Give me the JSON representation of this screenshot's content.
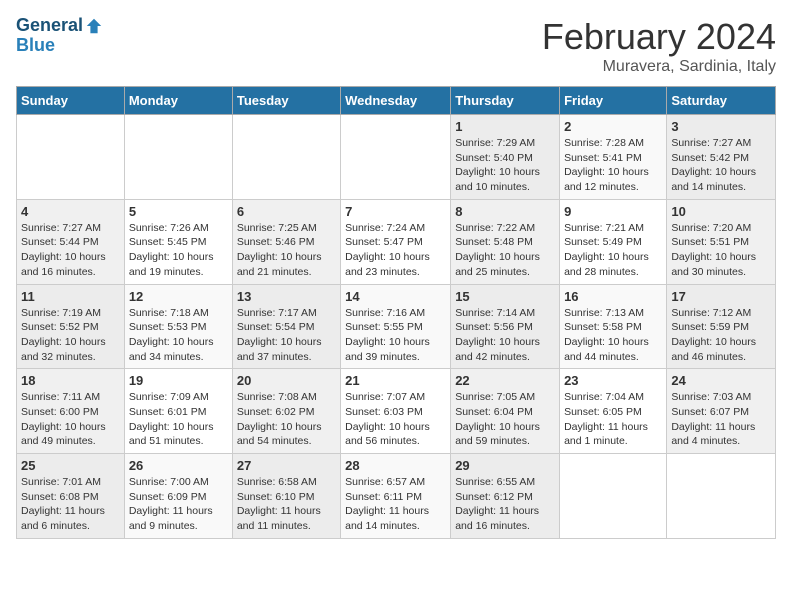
{
  "header": {
    "logo_general": "General",
    "logo_blue": "Blue",
    "month_title": "February 2024",
    "location": "Muravera, Sardinia, Italy"
  },
  "weekdays": [
    "Sunday",
    "Monday",
    "Tuesday",
    "Wednesday",
    "Thursday",
    "Friday",
    "Saturday"
  ],
  "weeks": [
    [
      {
        "day": "",
        "detail": ""
      },
      {
        "day": "",
        "detail": ""
      },
      {
        "day": "",
        "detail": ""
      },
      {
        "day": "",
        "detail": ""
      },
      {
        "day": "1",
        "detail": "Sunrise: 7:29 AM\nSunset: 5:40 PM\nDaylight: 10 hours\nand 10 minutes."
      },
      {
        "day": "2",
        "detail": "Sunrise: 7:28 AM\nSunset: 5:41 PM\nDaylight: 10 hours\nand 12 minutes."
      },
      {
        "day": "3",
        "detail": "Sunrise: 7:27 AM\nSunset: 5:42 PM\nDaylight: 10 hours\nand 14 minutes."
      }
    ],
    [
      {
        "day": "4",
        "detail": "Sunrise: 7:27 AM\nSunset: 5:44 PM\nDaylight: 10 hours\nand 16 minutes."
      },
      {
        "day": "5",
        "detail": "Sunrise: 7:26 AM\nSunset: 5:45 PM\nDaylight: 10 hours\nand 19 minutes."
      },
      {
        "day": "6",
        "detail": "Sunrise: 7:25 AM\nSunset: 5:46 PM\nDaylight: 10 hours\nand 21 minutes."
      },
      {
        "day": "7",
        "detail": "Sunrise: 7:24 AM\nSunset: 5:47 PM\nDaylight: 10 hours\nand 23 minutes."
      },
      {
        "day": "8",
        "detail": "Sunrise: 7:22 AM\nSunset: 5:48 PM\nDaylight: 10 hours\nand 25 minutes."
      },
      {
        "day": "9",
        "detail": "Sunrise: 7:21 AM\nSunset: 5:49 PM\nDaylight: 10 hours\nand 28 minutes."
      },
      {
        "day": "10",
        "detail": "Sunrise: 7:20 AM\nSunset: 5:51 PM\nDaylight: 10 hours\nand 30 minutes."
      }
    ],
    [
      {
        "day": "11",
        "detail": "Sunrise: 7:19 AM\nSunset: 5:52 PM\nDaylight: 10 hours\nand 32 minutes."
      },
      {
        "day": "12",
        "detail": "Sunrise: 7:18 AM\nSunset: 5:53 PM\nDaylight: 10 hours\nand 34 minutes."
      },
      {
        "day": "13",
        "detail": "Sunrise: 7:17 AM\nSunset: 5:54 PM\nDaylight: 10 hours\nand 37 minutes."
      },
      {
        "day": "14",
        "detail": "Sunrise: 7:16 AM\nSunset: 5:55 PM\nDaylight: 10 hours\nand 39 minutes."
      },
      {
        "day": "15",
        "detail": "Sunrise: 7:14 AM\nSunset: 5:56 PM\nDaylight: 10 hours\nand 42 minutes."
      },
      {
        "day": "16",
        "detail": "Sunrise: 7:13 AM\nSunset: 5:58 PM\nDaylight: 10 hours\nand 44 minutes."
      },
      {
        "day": "17",
        "detail": "Sunrise: 7:12 AM\nSunset: 5:59 PM\nDaylight: 10 hours\nand 46 minutes."
      }
    ],
    [
      {
        "day": "18",
        "detail": "Sunrise: 7:11 AM\nSunset: 6:00 PM\nDaylight: 10 hours\nand 49 minutes."
      },
      {
        "day": "19",
        "detail": "Sunrise: 7:09 AM\nSunset: 6:01 PM\nDaylight: 10 hours\nand 51 minutes."
      },
      {
        "day": "20",
        "detail": "Sunrise: 7:08 AM\nSunset: 6:02 PM\nDaylight: 10 hours\nand 54 minutes."
      },
      {
        "day": "21",
        "detail": "Sunrise: 7:07 AM\nSunset: 6:03 PM\nDaylight: 10 hours\nand 56 minutes."
      },
      {
        "day": "22",
        "detail": "Sunrise: 7:05 AM\nSunset: 6:04 PM\nDaylight: 10 hours\nand 59 minutes."
      },
      {
        "day": "23",
        "detail": "Sunrise: 7:04 AM\nSunset: 6:05 PM\nDaylight: 11 hours\nand 1 minute."
      },
      {
        "day": "24",
        "detail": "Sunrise: 7:03 AM\nSunset: 6:07 PM\nDaylight: 11 hours\nand 4 minutes."
      }
    ],
    [
      {
        "day": "25",
        "detail": "Sunrise: 7:01 AM\nSunset: 6:08 PM\nDaylight: 11 hours\nand 6 minutes."
      },
      {
        "day": "26",
        "detail": "Sunrise: 7:00 AM\nSunset: 6:09 PM\nDaylight: 11 hours\nand 9 minutes."
      },
      {
        "day": "27",
        "detail": "Sunrise: 6:58 AM\nSunset: 6:10 PM\nDaylight: 11 hours\nand 11 minutes."
      },
      {
        "day": "28",
        "detail": "Sunrise: 6:57 AM\nSunset: 6:11 PM\nDaylight: 11 hours\nand 14 minutes."
      },
      {
        "day": "29",
        "detail": "Sunrise: 6:55 AM\nSunset: 6:12 PM\nDaylight: 11 hours\nand 16 minutes."
      },
      {
        "day": "",
        "detail": ""
      },
      {
        "day": "",
        "detail": ""
      }
    ]
  ]
}
